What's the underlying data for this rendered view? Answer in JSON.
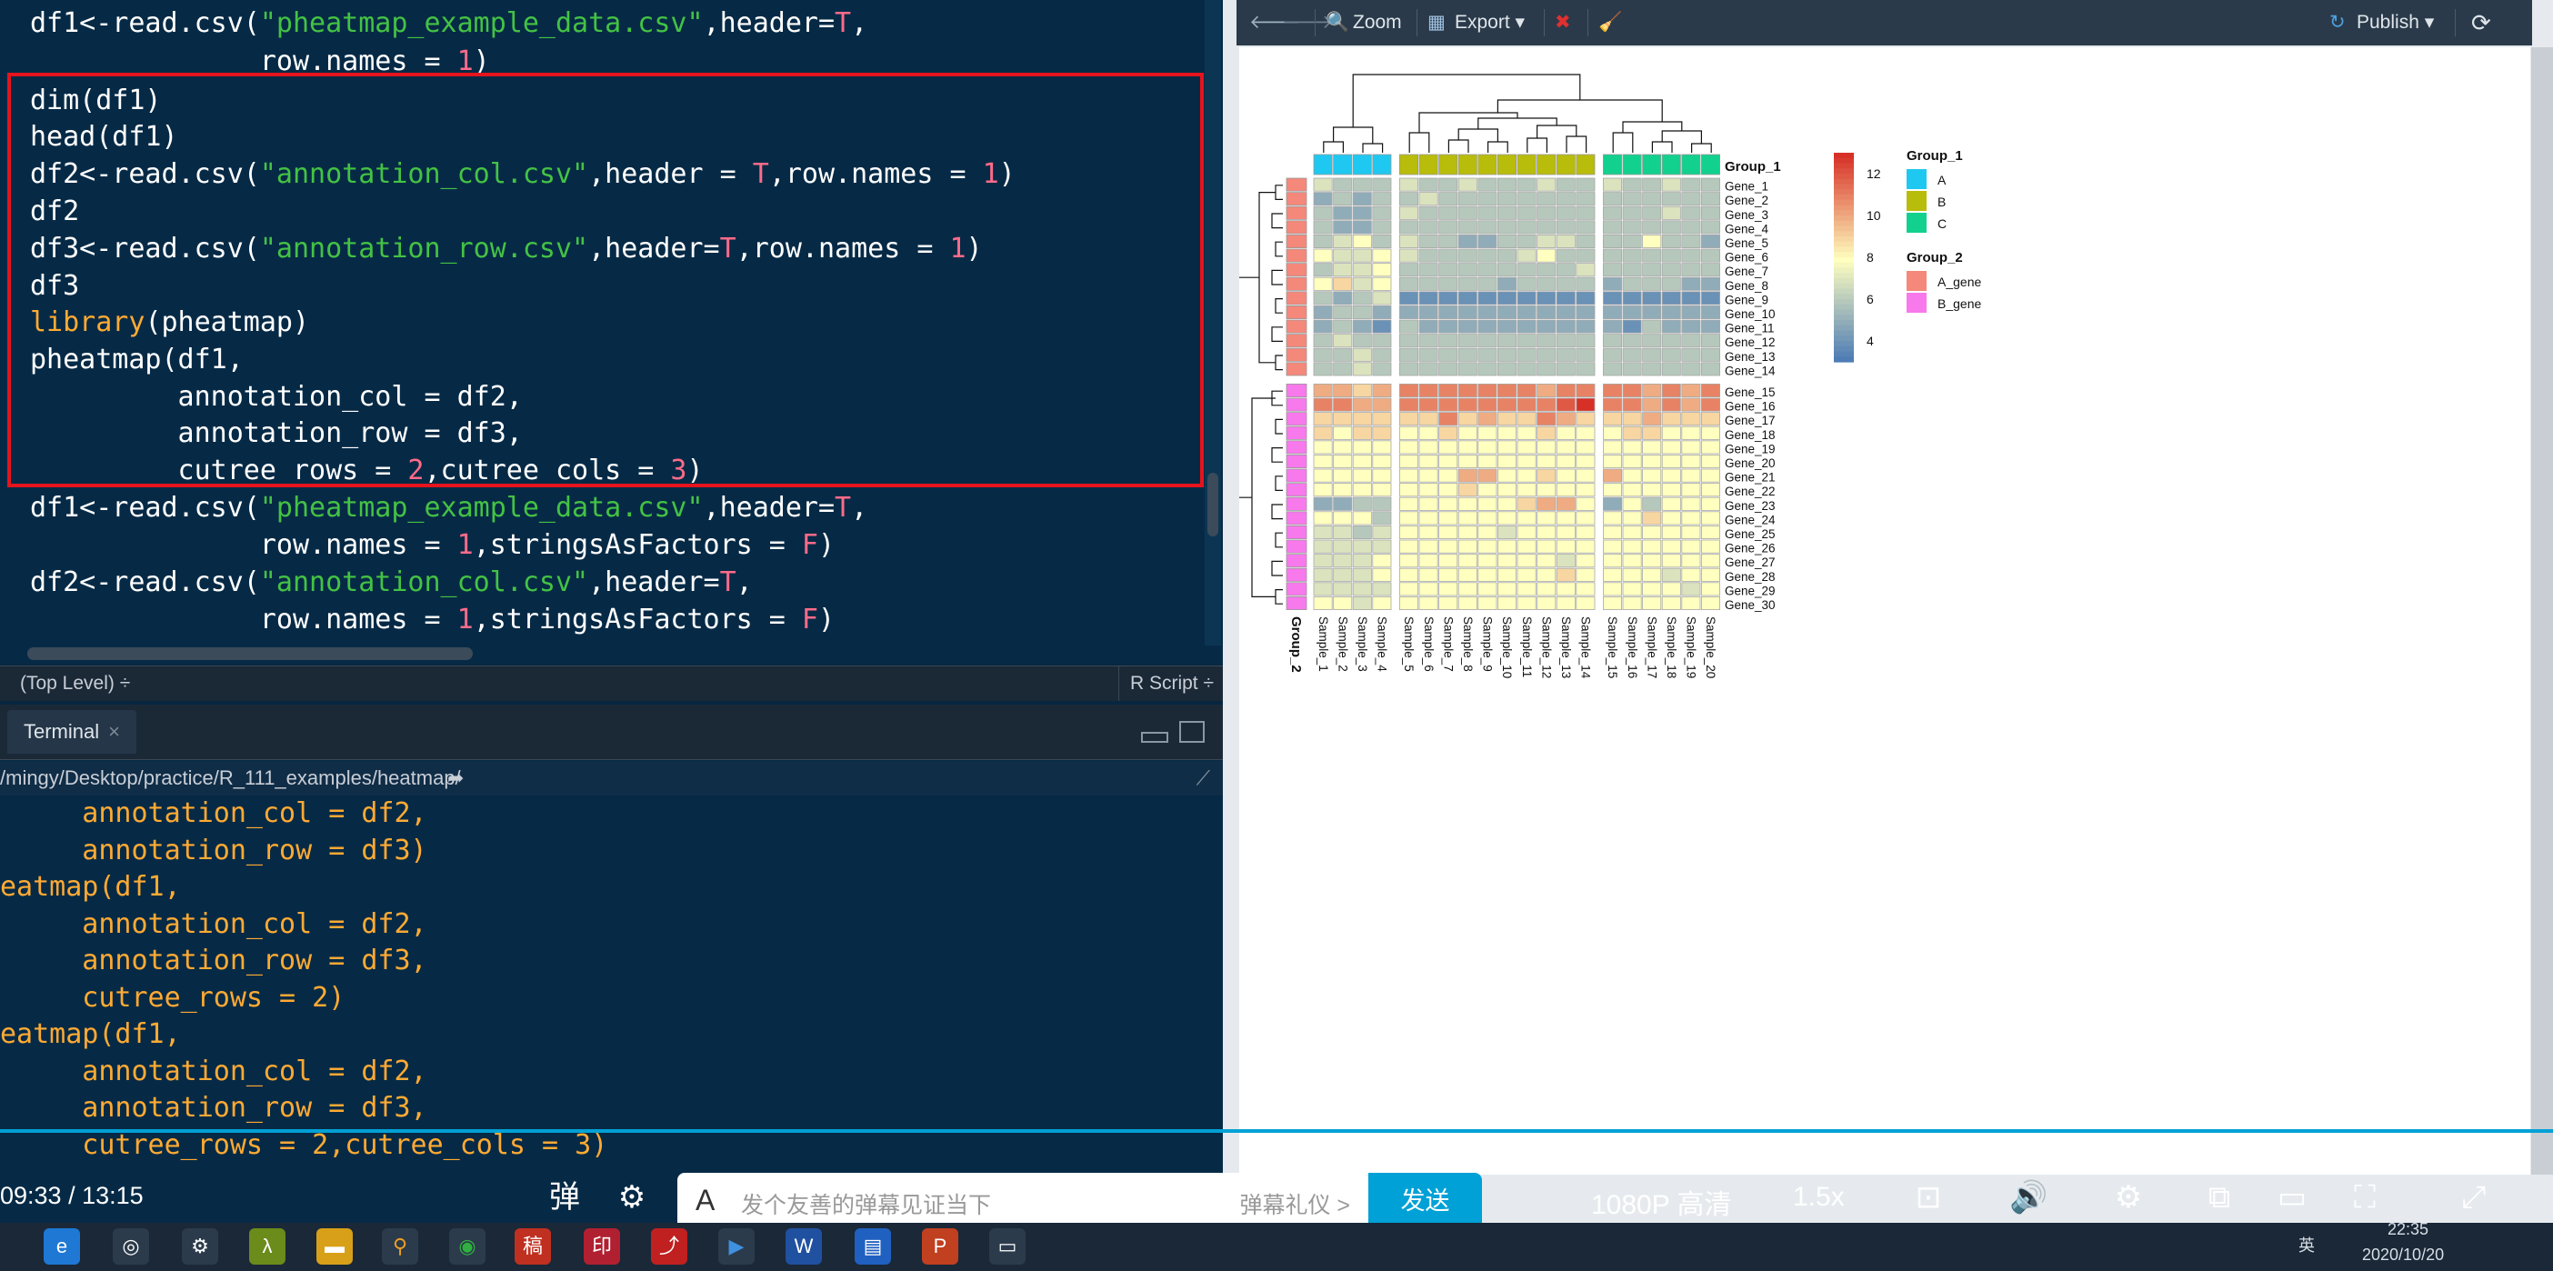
{
  "editor": {
    "lines": [
      [
        {
          "t": "df1<-read.csv("
        },
        {
          "t": "\"pheatmap_example_data.csv\"",
          "c": "str"
        },
        {
          "t": ",header="
        },
        {
          "t": "T",
          "c": "num"
        },
        {
          "t": ","
        }
      ],
      [
        {
          "t": "              row.names = "
        },
        {
          "t": "1",
          "c": "num"
        },
        {
          "t": ")"
        }
      ],
      [
        {
          "t": "dim(df1)"
        }
      ],
      [
        {
          "t": "head(df1)"
        }
      ],
      [
        {
          "t": "df2<-read.csv("
        },
        {
          "t": "\"annotation_col.csv\"",
          "c": "str"
        },
        {
          "t": ",header = "
        },
        {
          "t": "T",
          "c": "num"
        },
        {
          "t": ",row.names = "
        },
        {
          "t": "1",
          "c": "num"
        },
        {
          "t": ")"
        }
      ],
      [
        {
          "t": "df2"
        }
      ],
      [
        {
          "t": "df3<-read.csv("
        },
        {
          "t": "\"annotation_row.csv\"",
          "c": "str"
        },
        {
          "t": ",header="
        },
        {
          "t": "T",
          "c": "num"
        },
        {
          "t": ",row.names = "
        },
        {
          "t": "1",
          "c": "num"
        },
        {
          "t": ")"
        }
      ],
      [
        {
          "t": "df3"
        }
      ],
      [
        {
          "t": "library",
          "c": "kw"
        },
        {
          "t": "(pheatmap)"
        }
      ],
      [
        {
          "t": "pheatmap(df1,"
        }
      ],
      [
        {
          "t": "         annotation_col = df2,"
        }
      ],
      [
        {
          "t": "         annotation_row = df3,"
        }
      ],
      [
        {
          "t": "         cutree_rows = "
        },
        {
          "t": "2",
          "c": "num"
        },
        {
          "t": ",cutree_cols = "
        },
        {
          "t": "3",
          "c": "num"
        },
        {
          "t": ")"
        }
      ],
      [
        {
          "t": "df1<-read.csv("
        },
        {
          "t": "\"pheatmap_example_data.csv\"",
          "c": "str"
        },
        {
          "t": ",header="
        },
        {
          "t": "T",
          "c": "num"
        },
        {
          "t": ","
        }
      ],
      [
        {
          "t": "              row.names = "
        },
        {
          "t": "1",
          "c": "num"
        },
        {
          "t": ",stringsAsFactors = "
        },
        {
          "t": "F",
          "c": "num"
        },
        {
          "t": ")"
        }
      ],
      [
        {
          "t": "df2<-read.csv("
        },
        {
          "t": "\"annotation_col.csv\"",
          "c": "str"
        },
        {
          "t": ",header="
        },
        {
          "t": "T",
          "c": "num"
        },
        {
          "t": ","
        }
      ],
      [
        {
          "t": "              row.names = "
        },
        {
          "t": "1",
          "c": "num"
        },
        {
          "t": ",stringsAsFactors = "
        },
        {
          "t": "F",
          "c": "num"
        },
        {
          "t": ")"
        }
      ]
    ]
  },
  "statusbar": {
    "level": "(Top Level) ÷",
    "filetype": "R Script ÷"
  },
  "console": {
    "tab_label": "Terminal",
    "tab_close": "×",
    "path": "/mingy/Desktop/practice/R_111_examples/heatmap/",
    "lines": [
      "     annotation_col = df2,",
      "     annotation_row = df3)",
      "eatmap(df1,",
      "     annotation_col = df2,",
      "     annotation_row = df3,",
      "     cutree_rows = 2)",
      "eatmap(df1,",
      "     annotation_col = df2,",
      "     annotation_row = df3,",
      "     cutree_rows = 2,cutree_cols = 3)"
    ]
  },
  "viewer_toolbar": {
    "zoom": "Zoom",
    "export": "Export ▾",
    "publish": "Publish ▾"
  },
  "heatmap": {
    "samples": [
      "Sample_1",
      "Sample_2",
      "Sample_3",
      "Sample_4",
      "Sample_5",
      "Sample_6",
      "Sample_7",
      "Sample_8",
      "Sample_9",
      "Sample_10",
      "Sample_11",
      "Sample_12",
      "Sample_13",
      "Sample_14",
      "Sample_15",
      "Sample_16",
      "Sample_17",
      "Sample_18",
      "Sample_19",
      "Sample_20"
    ],
    "genes": [
      "Gene_1",
      "Gene_2",
      "Gene_3",
      "Gene_4",
      "Gene_5",
      "Gene_6",
      "Gene_7",
      "Gene_8",
      "Gene_9",
      "Gene_10",
      "Gene_11",
      "Gene_12",
      "Gene_13",
      "Gene_14",
      "Gene_15",
      "Gene_16",
      "Gene_17",
      "Gene_18",
      "Gene_19",
      "Gene_20",
      "Gene_21",
      "Gene_22",
      "Gene_23",
      "Gene_24",
      "Gene_25",
      "Gene_26",
      "Gene_27",
      "Gene_28",
      "Gene_29",
      "Gene_30"
    ],
    "col_groups": [
      {
        "label": "A",
        "color": "#1fc8f0",
        "count": 4
      },
      {
        "label": "B",
        "color": "#b8bc0a",
        "count": 10
      },
      {
        "label": "C",
        "color": "#12d18e",
        "count": 6
      }
    ],
    "row_groups": [
      {
        "label": "A_gene",
        "color": "#f4887a",
        "count": 14
      },
      {
        "label": "B_gene",
        "color": "#f779ec",
        "count": 16
      }
    ],
    "col_annotation_label": "Group_1",
    "row_annotation_label": "Group_2",
    "legend_ticks": [
      "12",
      "10",
      "8",
      "6",
      "4"
    ],
    "legend_group1_title": "Group_1",
    "legend_group2_title": "Group_2",
    "value_range": [
      3,
      13
    ],
    "colors": {
      "low": "#4575b4",
      "mid": "#ffffbf",
      "high": "#d73027"
    }
  },
  "chart_data": {
    "type": "heatmap",
    "title": "",
    "x_categories": [
      "Sample_1",
      "Sample_2",
      "Sample_3",
      "Sample_4",
      "Sample_5",
      "Sample_6",
      "Sample_7",
      "Sample_8",
      "Sample_9",
      "Sample_10",
      "Sample_11",
      "Sample_12",
      "Sample_13",
      "Sample_14",
      "Sample_15",
      "Sample_16",
      "Sample_17",
      "Sample_18",
      "Sample_19",
      "Sample_20"
    ],
    "y_categories": [
      "Gene_1",
      "Gene_2",
      "Gene_3",
      "Gene_4",
      "Gene_5",
      "Gene_6",
      "Gene_7",
      "Gene_8",
      "Gene_9",
      "Gene_10",
      "Gene_11",
      "Gene_12",
      "Gene_13",
      "Gene_14",
      "Gene_15",
      "Gene_16",
      "Gene_17",
      "Gene_18",
      "Gene_19",
      "Gene_20",
      "Gene_21",
      "Gene_22",
      "Gene_23",
      "Gene_24",
      "Gene_25",
      "Gene_26",
      "Gene_27",
      "Gene_28",
      "Gene_29",
      "Gene_30"
    ],
    "color_scale": {
      "min": 3,
      "max": 13,
      "ticks": [
        4,
        6,
        8,
        10,
        12
      ]
    },
    "values": [
      [
        7,
        6,
        6,
        6,
        7,
        6,
        6,
        7,
        6,
        6,
        6,
        7,
        6,
        6,
        7,
        6,
        6,
        7,
        6,
        6
      ],
      [
        5,
        6,
        5,
        6,
        6,
        7,
        6,
        6,
        6,
        6,
        6,
        6,
        6,
        6,
        6,
        6,
        6,
        6,
        6,
        6
      ],
      [
        6,
        5,
        5,
        6,
        7,
        6,
        6,
        6,
        6,
        6,
        6,
        6,
        6,
        6,
        6,
        6,
        6,
        7,
        6,
        6
      ],
      [
        6,
        5,
        5,
        6,
        6,
        6,
        6,
        6,
        6,
        6,
        6,
        6,
        6,
        6,
        6,
        6,
        6,
        6,
        6,
        6
      ],
      [
        6,
        7,
        8,
        6,
        7,
        6,
        6,
        5,
        5,
        6,
        6,
        7,
        7,
        6,
        6,
        6,
        8,
        6,
        6,
        5
      ],
      [
        8,
        7,
        7,
        8,
        7,
        6,
        6,
        6,
        6,
        6,
        7,
        8,
        6,
        6,
        6,
        6,
        6,
        6,
        6,
        6
      ],
      [
        6,
        7,
        7,
        8,
        6,
        6,
        6,
        6,
        6,
        6,
        6,
        6,
        6,
        7,
        6,
        6,
        6,
        6,
        6,
        6
      ],
      [
        8,
        9,
        7,
        8,
        6,
        6,
        6,
        6,
        6,
        5,
        6,
        6,
        6,
        6,
        5,
        6,
        6,
        6,
        5,
        5
      ],
      [
        6,
        5,
        6,
        7,
        4,
        4,
        4,
        4,
        4,
        4,
        4,
        4,
        4,
        4,
        4,
        4,
        4,
        4,
        4,
        4
      ],
      [
        5,
        6,
        6,
        5,
        5,
        5,
        5,
        5,
        5,
        5,
        5,
        5,
        5,
        5,
        5,
        5,
        5,
        5,
        5,
        5
      ],
      [
        5,
        6,
        5,
        4,
        6,
        5,
        5,
        5,
        5,
        5,
        5,
        5,
        5,
        5,
        5,
        4,
        6,
        5,
        5,
        5
      ],
      [
        6,
        7,
        6,
        6,
        6,
        6,
        6,
        6,
        6,
        6,
        6,
        6,
        6,
        6,
        6,
        6,
        6,
        6,
        6,
        6
      ],
      [
        6,
        6,
        7,
        6,
        6,
        6,
        6,
        6,
        6,
        6,
        6,
        6,
        6,
        6,
        6,
        6,
        6,
        6,
        6,
        6
      ],
      [
        6,
        6,
        7,
        6,
        6,
        6,
        6,
        6,
        6,
        6,
        6,
        6,
        6,
        6,
        6,
        6,
        6,
        6,
        6,
        6
      ],
      [
        10,
        10,
        9,
        10,
        11,
        11,
        11,
        11,
        11,
        11,
        11,
        10,
        11,
        11,
        11,
        11,
        10,
        11,
        10,
        11
      ],
      [
        11,
        11,
        10,
        10,
        11,
        11,
        11,
        11,
        11,
        11,
        11,
        11,
        12,
        13,
        11,
        11,
        10,
        11,
        10,
        11
      ],
      [
        9,
        9,
        9,
        9,
        9,
        9,
        11,
        9,
        10,
        9,
        9,
        11,
        10,
        9,
        9,
        9,
        10,
        9,
        9,
        9
      ],
      [
        9,
        8,
        9,
        9,
        8,
        8,
        9,
        8,
        8,
        8,
        8,
        9,
        8,
        8,
        8,
        9,
        9,
        8,
        8,
        8
      ],
      [
        8,
        8,
        8,
        8,
        8,
        8,
        8,
        8,
        8,
        8,
        8,
        8,
        8,
        8,
        8,
        8,
        8,
        8,
        8,
        8
      ],
      [
        8,
        8,
        8,
        8,
        8,
        8,
        8,
        8,
        8,
        8,
        8,
        8,
        8,
        8,
        8,
        8,
        8,
        8,
        8,
        8
      ],
      [
        8,
        8,
        8,
        8,
        8,
        8,
        8,
        10,
        10,
        8,
        8,
        9,
        8,
        8,
        10,
        8,
        8,
        8,
        8,
        8
      ],
      [
        8,
        8,
        8,
        8,
        8,
        8,
        8,
        9,
        8,
        8,
        8,
        8,
        8,
        8,
        8,
        8,
        8,
        8,
        8,
        8
      ],
      [
        5,
        5,
        6,
        6,
        8,
        8,
        8,
        8,
        8,
        8,
        9,
        10,
        10,
        8,
        5,
        8,
        6,
        8,
        8,
        8
      ],
      [
        8,
        8,
        8,
        6,
        8,
        8,
        8,
        8,
        8,
        8,
        8,
        8,
        8,
        8,
        8,
        8,
        9,
        8,
        8,
        8
      ],
      [
        7,
        7,
        6,
        7,
        8,
        8,
        8,
        8,
        8,
        7,
        8,
        8,
        8,
        8,
        8,
        8,
        8,
        8,
        8,
        8
      ],
      [
        7,
        7,
        7,
        7,
        8,
        8,
        8,
        8,
        8,
        8,
        8,
        8,
        8,
        8,
        8,
        8,
        8,
        8,
        8,
        8
      ],
      [
        7,
        7,
        7,
        8,
        8,
        8,
        8,
        8,
        8,
        8,
        8,
        8,
        7,
        8,
        8,
        8,
        8,
        8,
        8,
        8
      ],
      [
        7,
        7,
        7,
        8,
        8,
        8,
        8,
        8,
        8,
        8,
        8,
        8,
        9,
        8,
        8,
        8,
        8,
        7,
        8,
        8
      ],
      [
        7,
        7,
        7,
        7,
        8,
        8,
        8,
        8,
        8,
        8,
        8,
        8,
        8,
        8,
        8,
        8,
        8,
        8,
        7,
        8
      ],
      [
        8,
        8,
        7,
        8,
        8,
        8,
        8,
        8,
        8,
        8,
        8,
        8,
        8,
        8,
        8,
        8,
        8,
        8,
        8,
        8
      ]
    ]
  },
  "player": {
    "time": "09:33 / 13:15",
    "danmu_placeholder": "发个友善的弹幕见证当下",
    "danmu_etiquette": "弹幕礼仪 >",
    "send": "发送",
    "quality": "1080P 高清",
    "speed": "1.5x"
  },
  "taskbar": {
    "time": "22:35",
    "date": "2020/10/20",
    "ime": "英"
  }
}
